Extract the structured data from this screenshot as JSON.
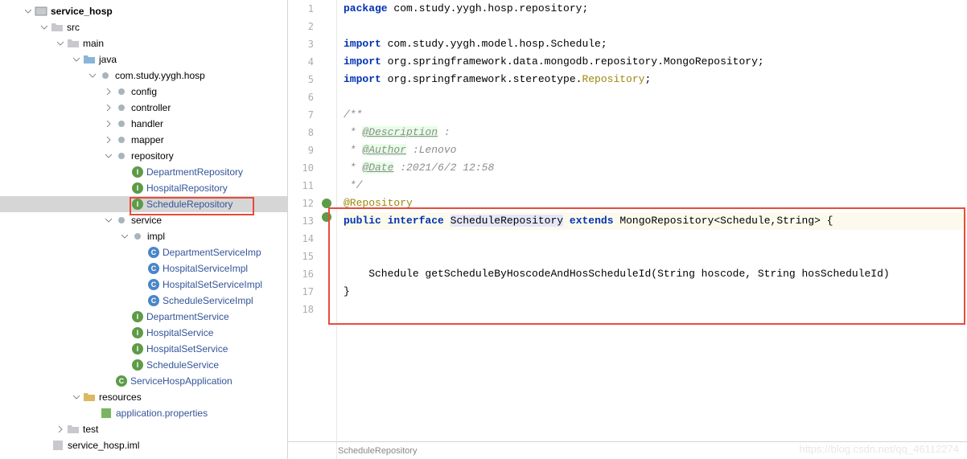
{
  "tree": {
    "root": "service_hosp",
    "src": "src",
    "main": "main",
    "java": "java",
    "package": "com.study.yygh.hosp",
    "config": "config",
    "controller": "controller",
    "handler": "handler",
    "mapper": "mapper",
    "repository": "repository",
    "repo_items": [
      "DepartmentRepository",
      "HospitalRepository",
      "ScheduleRepository"
    ],
    "service": "service",
    "impl": "impl",
    "impl_items": [
      "DepartmentServiceImp",
      "HospitalServiceImpl",
      "HospitalSetServiceImpl",
      "ScheduleServiceImpl"
    ],
    "service_items": [
      "DepartmentService",
      "HospitalService",
      "HospitalSetService",
      "ScheduleService"
    ],
    "app_class": "ServiceHospApplication",
    "resources": "resources",
    "app_props": "application.properties",
    "test": "test",
    "iml": "service_hosp.iml"
  },
  "code": {
    "line1_kw": "package",
    "line1_rest": " com.study.yygh.hosp.repository;",
    "line3_kw": "import",
    "line3_rest": " com.study.yygh.model.hosp.Schedule;",
    "line4_kw": "import",
    "line4_rest": " org.springframework.data.mongodb.repository.MongoRepository;",
    "line5_kw": "import",
    "line5_rest": " org.springframework.stereotype.",
    "line5_end": "Repository",
    "line5_semi": ";",
    "line7": "/**",
    "line8_pre": " * ",
    "line8_tag": "@Description",
    "line8_rest": " :",
    "line9_pre": " * ",
    "line9_tag": "@Author",
    "line9_rest": " :Lenovo",
    "line10_pre": " * ",
    "line10_tag": "@Date",
    "line10_rest": " :2021/6/2 12:58",
    "line11": " */",
    "line12": "@Repository",
    "line13_kw1": "public",
    "line13_kw2": "interface",
    "line13_name": "ScheduleRepository",
    "line13_kw3": "extends",
    "line13_rest": " MongoRepository<Schedule,String> {",
    "line16": "    Schedule getScheduleByHoscodeAndHosScheduleId(String hoscode, String hosScheduleId)",
    "line17": "}"
  },
  "status": "ScheduleRepository",
  "watermark": "https://blog.csdn.net/qq_46112274"
}
